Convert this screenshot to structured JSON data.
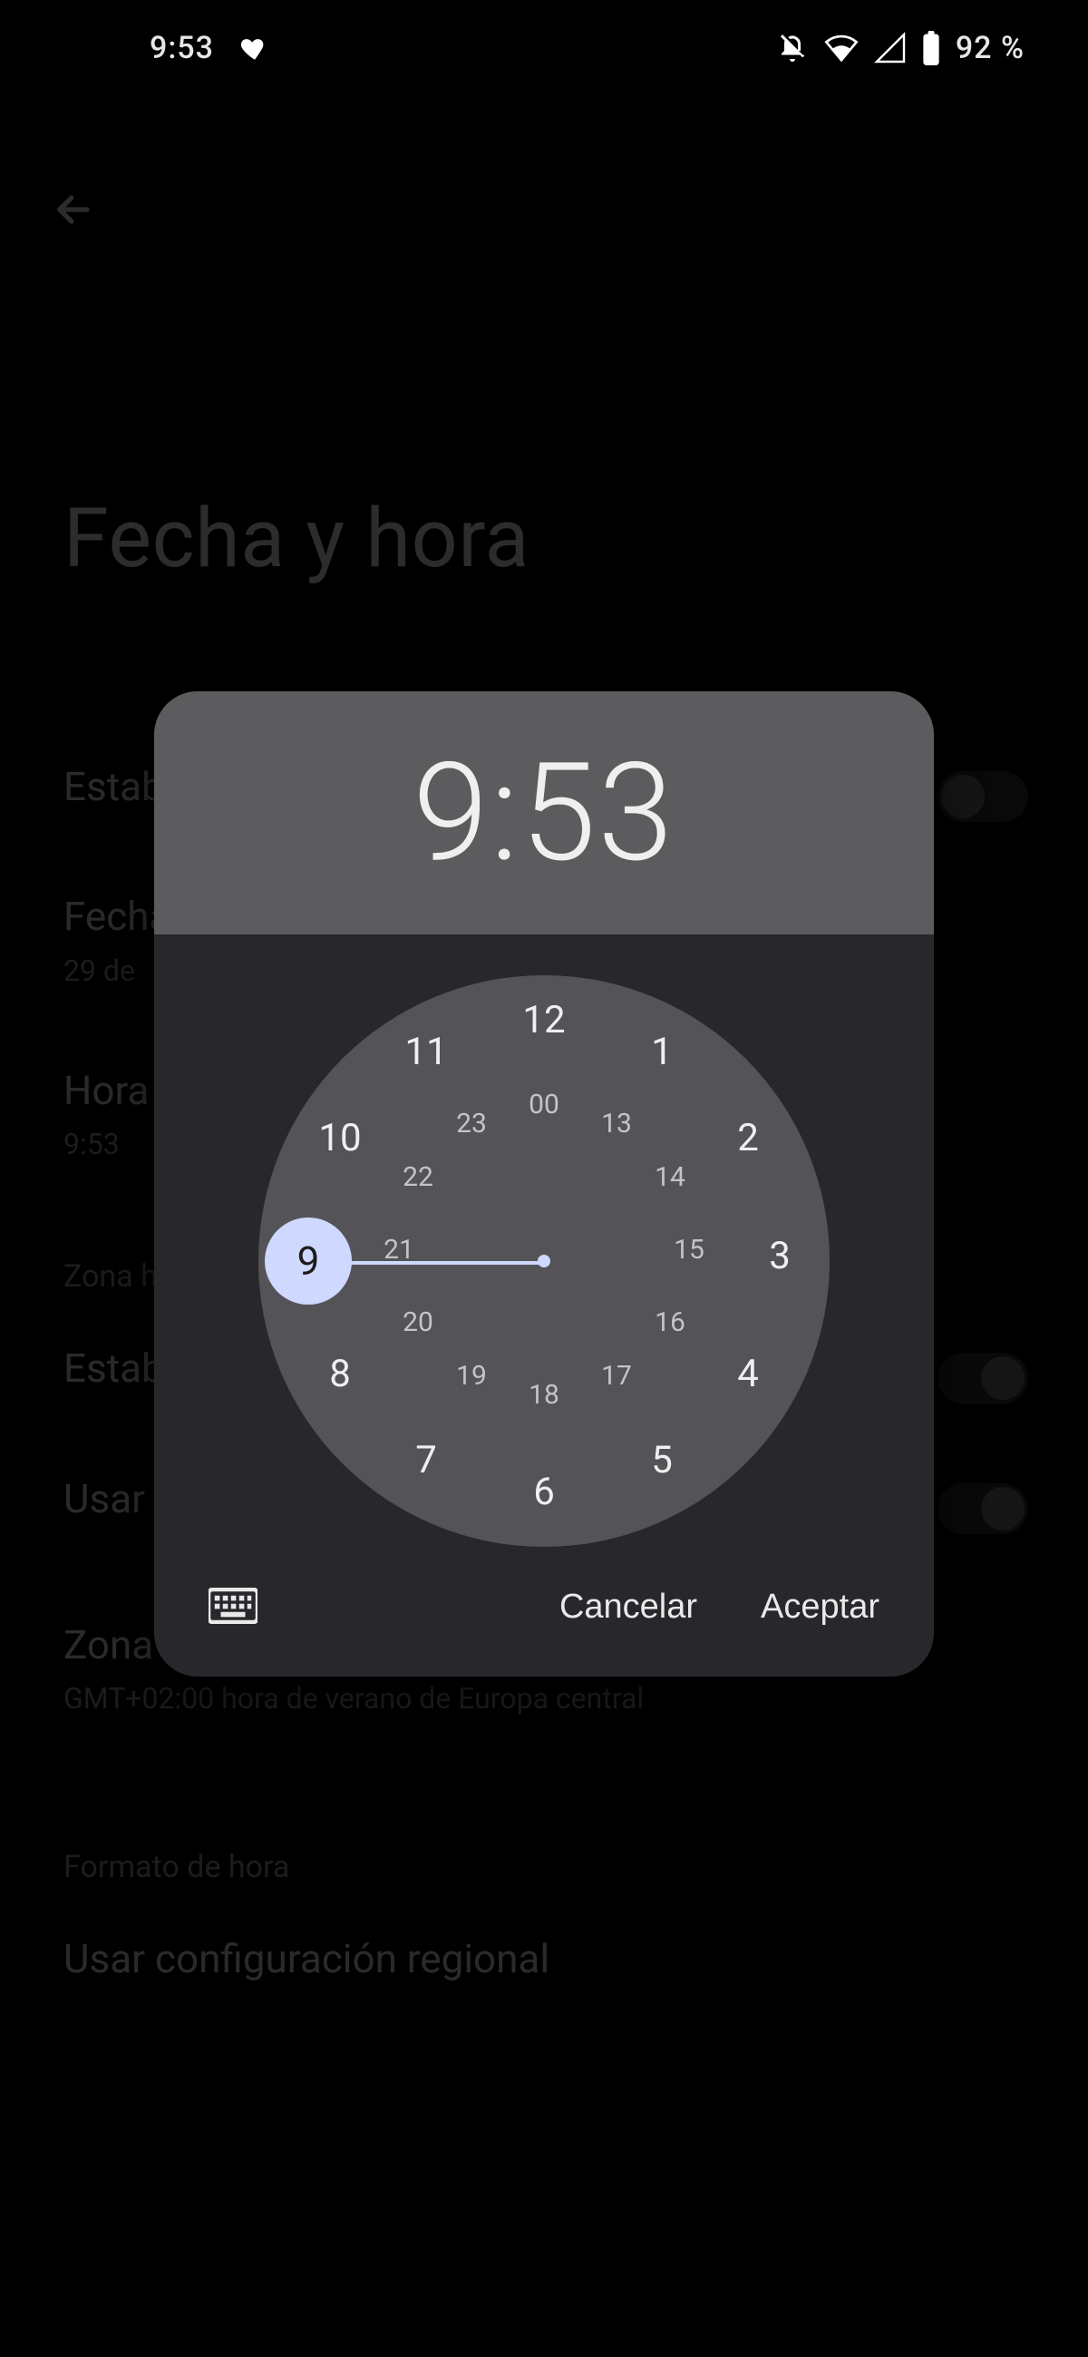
{
  "status_bar": {
    "time": "9:53",
    "battery_pct": "92 %"
  },
  "page": {
    "title": "Fecha y hora",
    "rows": {
      "auto_time": {
        "primary": "Establecer hora automáticamente"
      },
      "date": {
        "primary": "Fecha",
        "secondary": "29 de"
      },
      "time": {
        "primary": "Hora",
        "secondary": "9:53"
      },
      "tz_section": {
        "label": "Zona horaria"
      },
      "auto_tz": {
        "primary": "Establecer zona horaria automáticamente"
      },
      "use_loc": {
        "primary": "Usar ubicación para establecer la zona horaria"
      },
      "tz": {
        "primary": "Zona horaria",
        "secondary": "GMT+02:00 hora de verano de Europa central"
      },
      "fmt_section": {
        "label": "Formato de hora"
      },
      "use_locale": {
        "primary": "Usar configuración regional"
      }
    }
  },
  "dialog": {
    "hour": "9",
    "minute": "53",
    "selected_hour": "9",
    "outer_hours": [
      "12",
      "1",
      "2",
      "3",
      "4",
      "5",
      "6",
      "7",
      "8",
      "9",
      "10",
      "11"
    ],
    "inner_hours": [
      "00",
      "13",
      "14",
      "15",
      "16",
      "17",
      "18",
      "19",
      "20",
      "21",
      "22",
      "23"
    ],
    "cancel": "Cancelar",
    "accept": "Aceptar"
  }
}
